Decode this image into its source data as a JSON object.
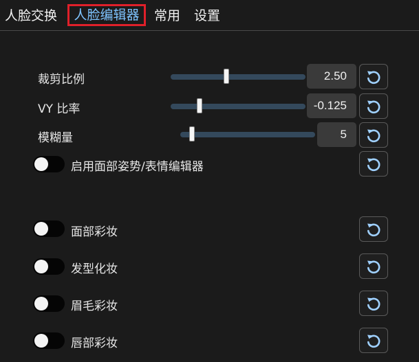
{
  "tabs": [
    {
      "label": "人脸交换"
    },
    {
      "label": "人脸编辑器"
    },
    {
      "label": "常用"
    },
    {
      "label": "设置"
    }
  ],
  "active_tab": "人脸编辑器",
  "accent_color": "#7ec3ff",
  "highlight_color": "#e0202a",
  "sliders": [
    {
      "label": "裁剪比例",
      "value": "2.50",
      "level": 0.41
    },
    {
      "label": "VY 比率",
      "value": "-0.125",
      "level": 0.2
    },
    {
      "label": "模糊量",
      "value": "5",
      "level": 0.07
    }
  ],
  "toggles": [
    {
      "label": "启用面部姿势/表情编辑器",
      "on": false
    },
    {
      "label": "面部彩妆",
      "on": false
    },
    {
      "label": "发型化妆",
      "on": false
    },
    {
      "label": "眉毛彩妆",
      "on": false
    },
    {
      "label": "唇部彩妆",
      "on": false
    }
  ],
  "reset_icon": "reset-icon"
}
